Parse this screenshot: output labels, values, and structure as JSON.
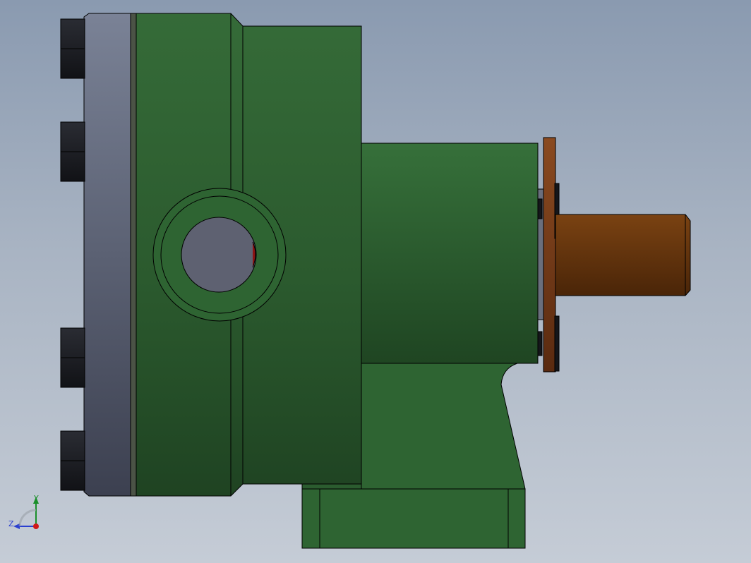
{
  "viewport": {
    "background_top": "#8a9ab0",
    "background_bottom": "#c5ccd6"
  },
  "model": {
    "part_colors": {
      "housing": "#2f6634",
      "flange": "#5c6478",
      "bolts": "#1b1d22",
      "shaft": "#6b3a10",
      "disc": "#7a3c18"
    }
  },
  "triad": {
    "y_label": "Y",
    "z_label": "Z",
    "colors": {
      "y": "#1a8f2a",
      "z": "#2a3fd0",
      "x": "#d01818"
    }
  }
}
